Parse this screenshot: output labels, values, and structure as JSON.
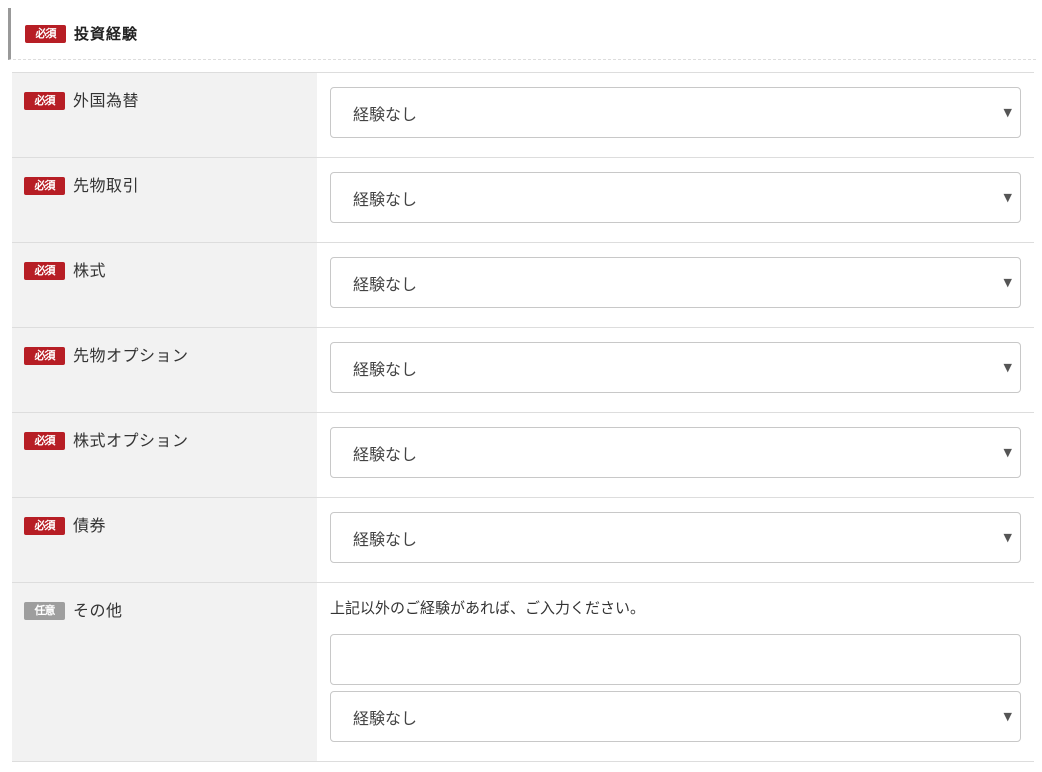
{
  "section": {
    "title": "投資経験",
    "badge": "必須"
  },
  "badges": {
    "required": "必須",
    "optional": "任意"
  },
  "rows": [
    {
      "label": "外国為替",
      "value": "経験なし"
    },
    {
      "label": "先物取引",
      "value": "経験なし"
    },
    {
      "label": "株式",
      "value": "経験なし"
    },
    {
      "label": "先物オプション",
      "value": "経験なし"
    },
    {
      "label": "株式オプション",
      "value": "経験なし"
    },
    {
      "label": "債券",
      "value": "経験なし"
    }
  ],
  "other": {
    "label": "その他",
    "helper": "上記以外のご経験があれば、ご入力ください。",
    "input_value": "",
    "select_value": "経験なし"
  },
  "icons": {
    "dropdown": "chevron-down-icon",
    "dropdown_glyph": "⌄"
  },
  "colors": {
    "required_badge": "#b71e25",
    "optional_badge": "#9e9e9e",
    "label_bg": "#f2f2f2"
  }
}
